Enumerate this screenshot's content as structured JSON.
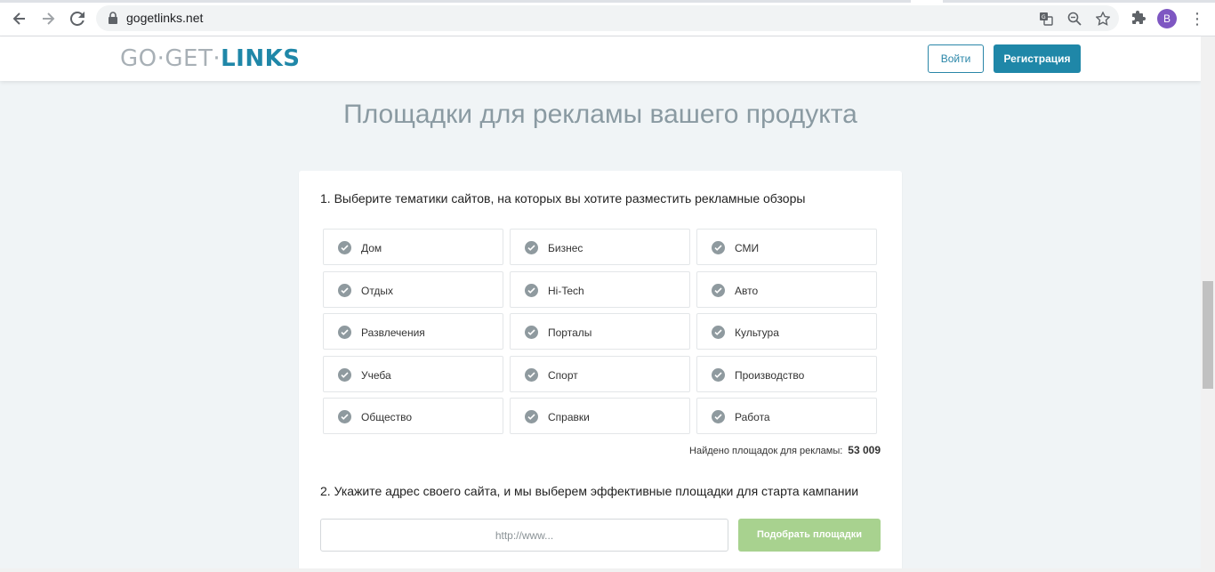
{
  "browser": {
    "url": "gogetlinks.net",
    "avatar_letter": "B"
  },
  "header": {
    "logo_light_1": "GO·GET·",
    "logo_bold": "LINKS",
    "login_label": "Войти",
    "register_label": "Регистрация"
  },
  "page": {
    "title": "Площадки для рекламы вашего продукта"
  },
  "step1": {
    "title": "1. Выберите тематики сайтов, на которых вы хотите разместить рекламные обзоры",
    "topics": [
      "Дом",
      "Бизнес",
      "СМИ",
      "Отдых",
      "Hi-Tech",
      "Авто",
      "Развлечения",
      "Порталы",
      "Культура",
      "Учеба",
      "Спорт",
      "Производство",
      "Общество",
      "Справки",
      "Работа"
    ],
    "found_label": "Найдено площадок для рекламы:",
    "found_count": "53 009"
  },
  "step2": {
    "title": "2. Укажите адрес своего сайта, и мы выберем эффективные площадки для старта кампании",
    "input_placeholder": "http://www...",
    "button_label": "Подобрать площадки"
  },
  "colors": {
    "brand": "#1f87a8",
    "check": "#8f9a9f",
    "pick_button": "#a8d28f"
  }
}
